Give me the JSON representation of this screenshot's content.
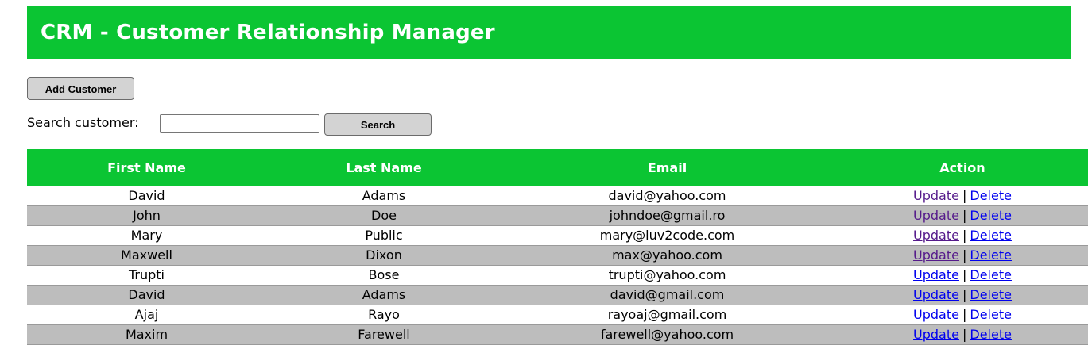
{
  "header": {
    "title": "CRM - Customer Relationship Manager"
  },
  "toolbar": {
    "add_label": "Add Customer",
    "search_label": "Search customer:",
    "search_value": "",
    "search_button_label": "Search"
  },
  "table": {
    "headers": [
      "First Name",
      "Last Name",
      "Email",
      "Action"
    ],
    "update_label": "Update",
    "separator": "|",
    "delete_label": "Delete",
    "rows": [
      {
        "first": "David",
        "last": "Adams",
        "email": "david@yahoo.com",
        "update_visited": true
      },
      {
        "first": "John",
        "last": "Doe",
        "email": "johndoe@gmail.ro",
        "update_visited": true
      },
      {
        "first": "Mary",
        "last": "Public",
        "email": "mary@luv2code.com",
        "update_visited": true
      },
      {
        "first": "Maxwell",
        "last": "Dixon",
        "email": "max@yahoo.com",
        "update_visited": true
      },
      {
        "first": "Trupti",
        "last": "Bose",
        "email": "trupti@yahoo.com",
        "update_visited": false
      },
      {
        "first": "David",
        "last": "Adams",
        "email": "david@gmail.com",
        "update_visited": false
      },
      {
        "first": "Ajaj",
        "last": "Rayo",
        "email": "rayoaj@gmail.com",
        "update_visited": false
      },
      {
        "first": "Maxim",
        "last": "Farewell",
        "email": "farewell@yahoo.com",
        "update_visited": false
      }
    ]
  },
  "colors": {
    "accent": "#0bc533",
    "link": "#0000ee",
    "visited_link": "#551a8b",
    "alt_row": "#bdbdbd"
  }
}
